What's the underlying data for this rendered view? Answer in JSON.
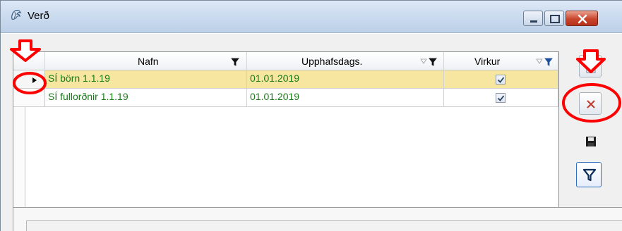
{
  "window": {
    "title": "Verð",
    "icon": "app-icon",
    "controls": [
      "minimize-icon",
      "maximize-icon",
      "close-icon"
    ]
  },
  "grid": {
    "columns": [
      {
        "label": "Nafn",
        "filter_icon": "filter-icon"
      },
      {
        "label": "Upphafsdags.",
        "filter_icon": "filter-icon"
      },
      {
        "label": "Virkur",
        "filter_icon": "filter-icon"
      }
    ],
    "rows": [
      {
        "nafn": "SÍ börn 1.1.19",
        "upphafsdags": "01.01.2019",
        "virkur": true,
        "selected": true
      },
      {
        "nafn": "SÍ fullorðnir 1.1.19",
        "upphafsdags": "01.01.2019",
        "virkur": true,
        "selected": false
      }
    ]
  },
  "sidebar_buttons": [
    "new-record-icon",
    "delete-icon",
    "save-icon",
    "filter-icon"
  ],
  "colors": {
    "selected_row": "#f6e6a0",
    "row_text_green": "#1a7a1a",
    "annotation_red": "#ff0000",
    "delete_red": "#c0392b",
    "filter_blue": "#1f4e9c"
  }
}
